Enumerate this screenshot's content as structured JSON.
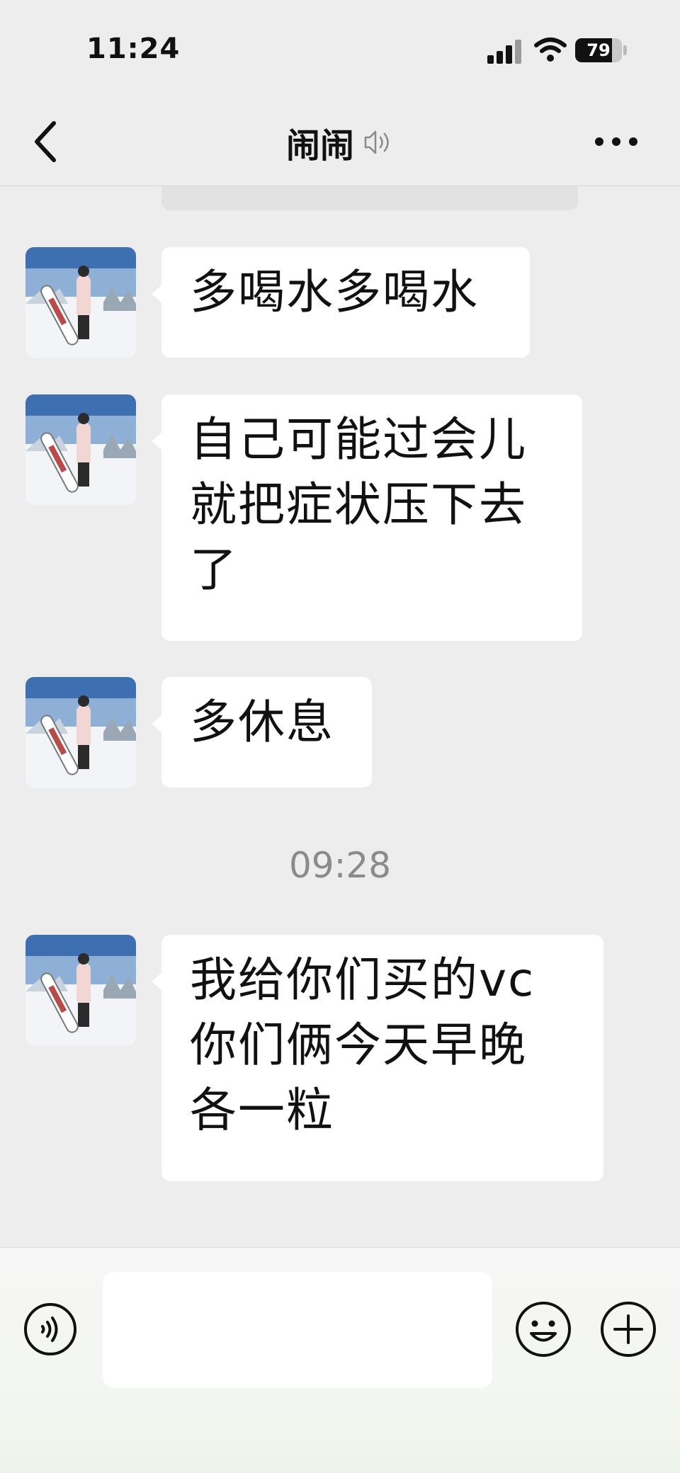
{
  "status_bar": {
    "time": "11:24",
    "battery_level": "79",
    "battery_fraction": 0.79,
    "signal_icon": "cellular-signal-icon",
    "wifi_icon": "wifi-icon"
  },
  "nav": {
    "back_icon": "chevron-left-icon",
    "title": "闹闹",
    "voice_mode_icon": "speaker-icon",
    "more_icon": "more-dots-icon"
  },
  "messages": [
    {
      "sender": "other",
      "text": "多喝水多喝水"
    },
    {
      "sender": "other",
      "lines": [
        "自己可能过会儿",
        "就把症状压下去",
        "了"
      ]
    },
    {
      "sender": "other",
      "text": "多休息"
    },
    {
      "type": "timestamp",
      "text": "09:28"
    },
    {
      "sender": "other",
      "lines": [
        "我给你们买的vc",
        "你们俩今天早晚",
        "各一粒"
      ]
    }
  ],
  "input_bar": {
    "voice_icon": "voice-input-icon",
    "input_value": "",
    "emoji_icon": "emoji-icon",
    "plus_icon": "plus-icon"
  },
  "colors": {
    "background": "#ededed",
    "bubble": "#ffffff",
    "timestamp": "#8a8a8a",
    "text": "#111111"
  }
}
